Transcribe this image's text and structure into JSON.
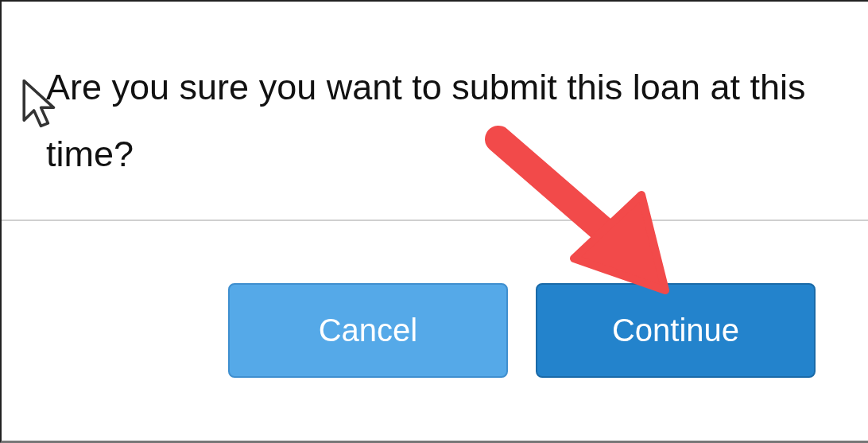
{
  "dialog": {
    "message": "Are you sure you want to submit this loan at this time?",
    "buttons": [
      {
        "label": "Cancel",
        "kind": "secondary"
      },
      {
        "label": "Continue",
        "kind": "primary"
      }
    ]
  }
}
